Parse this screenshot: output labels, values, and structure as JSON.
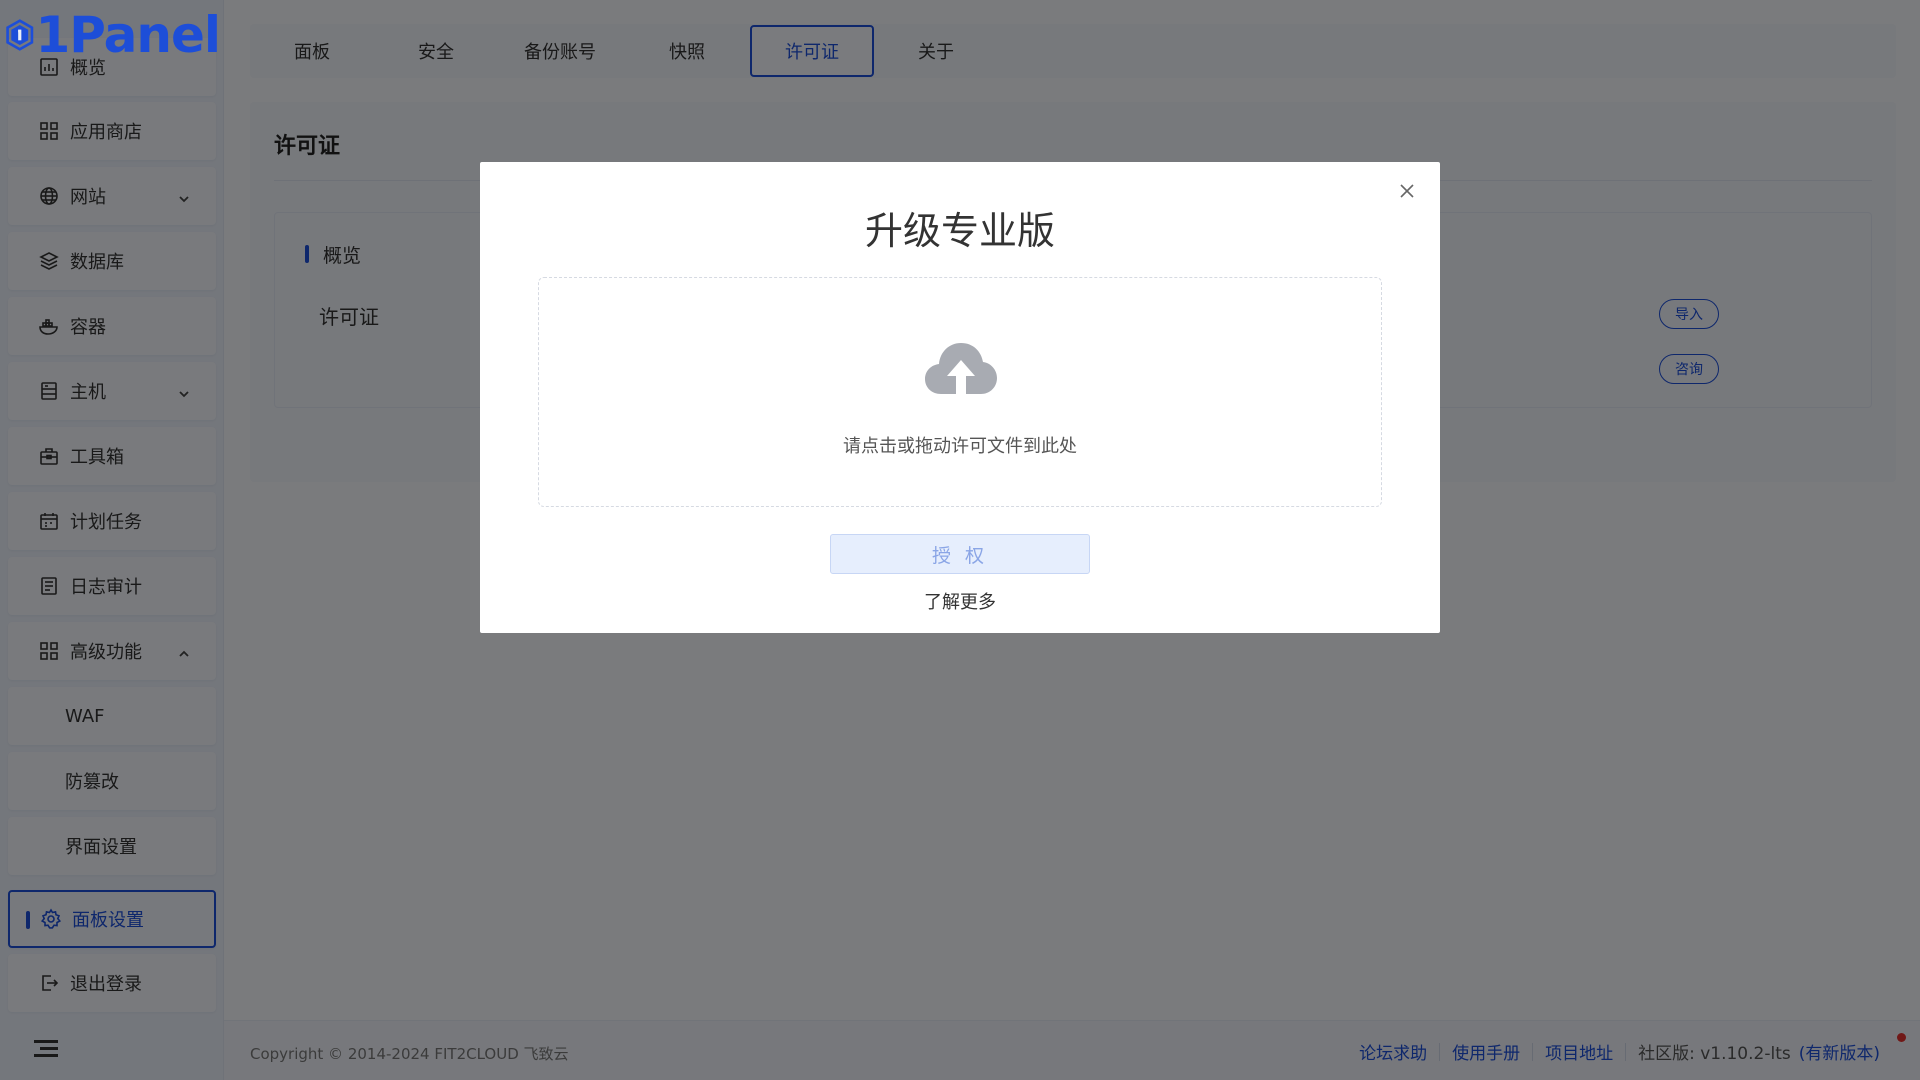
{
  "app": {
    "brand": "1Panel",
    "colors": {
      "accent": "#1d4ed8",
      "overlay": "rgba(0,0,0,0.5)",
      "notify_dot": "#e0302f"
    }
  },
  "sidebar": {
    "items": [
      {
        "label": "概览",
        "icon": "dashboard-icon"
      },
      {
        "label": "应用商店",
        "icon": "apps-grid-icon"
      },
      {
        "label": "网站",
        "icon": "globe-icon",
        "expandable": true
      },
      {
        "label": "数据库",
        "icon": "layers-icon"
      },
      {
        "label": "容器",
        "icon": "docker-icon"
      },
      {
        "label": "主机",
        "icon": "server-icon",
        "expandable": true
      },
      {
        "label": "工具箱",
        "icon": "toolbox-icon"
      },
      {
        "label": "计划任务",
        "icon": "calendar-icon"
      },
      {
        "label": "日志审计",
        "icon": "log-icon"
      },
      {
        "label": "高级功能",
        "icon": "apps-grid-icon",
        "expanded": true
      },
      {
        "label": "WAF"
      },
      {
        "label": "防篡改"
      },
      {
        "label": "界面设置"
      },
      {
        "label": "面板设置",
        "icon": "gear-icon",
        "active": true
      },
      {
        "label": "退出登录",
        "icon": "logout-icon"
      }
    ]
  },
  "tabs": [
    {
      "label": "面板"
    },
    {
      "label": "安全"
    },
    {
      "label": "备份账号"
    },
    {
      "label": "快照"
    },
    {
      "label": "许可证",
      "active": true
    },
    {
      "label": "关于"
    }
  ],
  "license_page": {
    "title": "许可证",
    "overview_label": "概览",
    "license_label": "许可证",
    "import_button": "导入",
    "consult_button": "咨询"
  },
  "dialog": {
    "title": "升级专业版",
    "dropzone_text": "请点击或拖动许可文件到此处",
    "authorize_button": "授 权",
    "learn_more": "了解更多"
  },
  "footer": {
    "copyright": "Copyright © 2014-2024 FIT2CLOUD 飞致云",
    "links": [
      "论坛求助",
      "使用手册",
      "项目地址"
    ],
    "version": "社区版: v1.10.2-lts",
    "new_version": "(有新版本)"
  }
}
